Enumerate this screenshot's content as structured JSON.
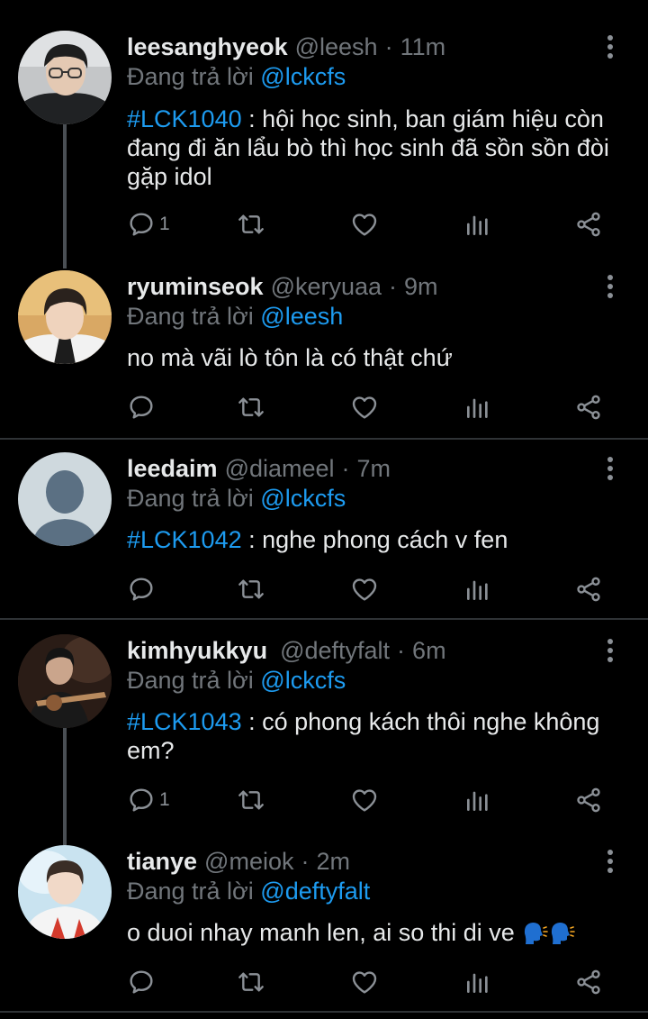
{
  "reply_prefix": "Đang trả lời",
  "tweets": [
    {
      "name": "leesanghyeok",
      "handle": "@leesh",
      "time": "11m",
      "reply_to": "@lckcfs",
      "hashtag": "#LCK1040",
      "text": " : hội học sinh, ban giám hiệu còn đang đi ăn lẩu bò thì học sinh đã sồn sồn đòi gặp idol",
      "reply_count": "1"
    },
    {
      "name": "ryuminseok",
      "handle": "@keryuaa",
      "time": "9m",
      "reply_to": "@leesh",
      "hashtag": "",
      "text": "no mà vãi lò tôn là có thật chứ",
      "reply_count": ""
    },
    {
      "name": "leedaim",
      "handle": "@diameel",
      "time": "7m",
      "reply_to": "@lckcfs",
      "hashtag": "#LCK1042",
      "text": " : nghe phong cách v fen",
      "reply_count": ""
    },
    {
      "name": "kimhyukkyu",
      "handle": "@deftyfalt",
      "time": "6m",
      "reply_to": "@lckcfs",
      "hashtag": "#LCK1043",
      "text": " : có phong kách thôi nghe không em?",
      "reply_count": "1"
    },
    {
      "name": "tianye",
      "handle": "@meiok",
      "time": "2m",
      "reply_to": "@deftyfalt",
      "hashtag": "",
      "text": "o duoi nhay manh len, ai so thi di ve ",
      "reply_count": ""
    }
  ],
  "colors": {
    "background": "#000000",
    "text": "#e7e9ea",
    "secondary": "#71767b",
    "accent": "#1d9bf0",
    "divider": "#2f3336"
  },
  "icons": {
    "reply": "speech-bubble-icon",
    "retweet": "retweet-icon",
    "like": "heart-icon",
    "views": "bar-chart-icon",
    "share": "share-icon",
    "more": "vertical-ellipsis-icon",
    "emoji": "speaking-head-emoji"
  }
}
